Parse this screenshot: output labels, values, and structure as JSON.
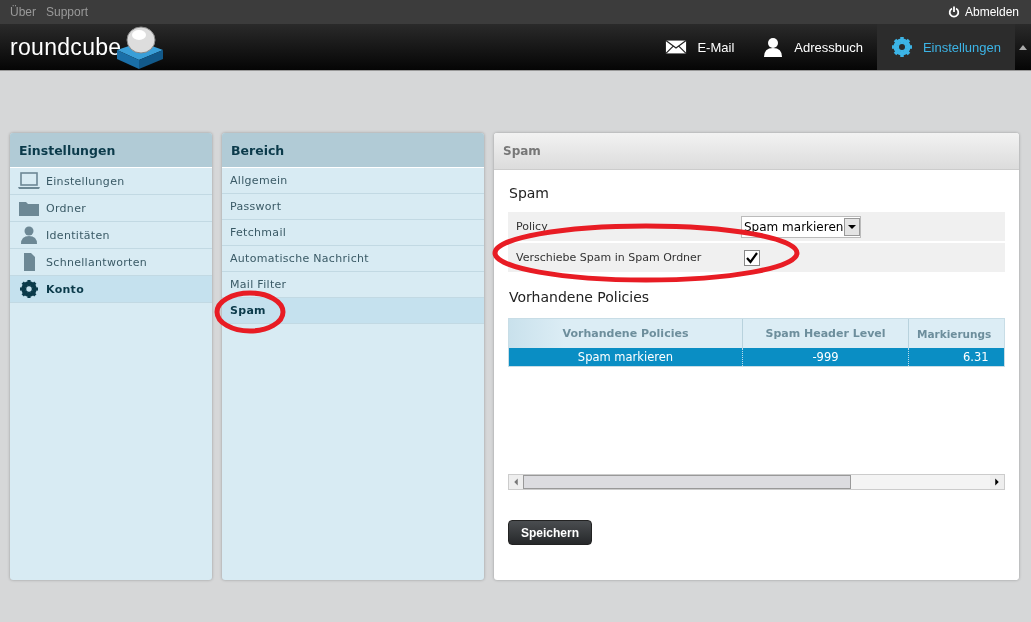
{
  "top_bar": {
    "links": [
      "Über",
      "Support"
    ],
    "logout": "Abmelden"
  },
  "header": {
    "logo": "roundcube",
    "nav": [
      {
        "label": "E-Mail",
        "kind": "mail",
        "selected": false
      },
      {
        "label": "Adressbuch",
        "kind": "contacts",
        "selected": false
      },
      {
        "label": "Einstellungen",
        "kind": "settings",
        "selected": true
      }
    ]
  },
  "settings_panel": {
    "title": "Einstellungen",
    "items": [
      {
        "label": "Einstellungen",
        "kind": "preferences",
        "selected": false
      },
      {
        "label": "Ordner",
        "kind": "folders",
        "selected": false
      },
      {
        "label": "Identitäten",
        "kind": "identities",
        "selected": false
      },
      {
        "label": "Schnellantworten",
        "kind": "responses",
        "selected": false
      },
      {
        "label": "Konto",
        "kind": "account",
        "selected": true
      }
    ]
  },
  "section_panel": {
    "title": "Bereich",
    "items": [
      {
        "label": "Allgemein",
        "selected": false
      },
      {
        "label": "Passwort",
        "selected": false
      },
      {
        "label": "Fetchmail",
        "selected": false
      },
      {
        "label": "Automatische Nachricht",
        "selected": false
      },
      {
        "label": "Mail Filter",
        "selected": false
      },
      {
        "label": "Spam",
        "selected": true
      }
    ]
  },
  "content": {
    "header": "Spam",
    "section_title": "Spam",
    "form": [
      {
        "kind": "select",
        "label": "Policy",
        "value": "Spam markieren"
      },
      {
        "kind": "checkbox",
        "label": "Verschiebe Spam in Spam Ordner",
        "checked": true
      }
    ],
    "policies_title": "Vorhandene Policies",
    "table": {
      "columns": [
        "Vorhandene Policies",
        "Spam Header Level",
        "Markierungs"
      ],
      "rows": [
        {
          "cells": [
            "Spam markieren",
            "-999",
            "6.31"
          ],
          "selected": true
        }
      ]
    },
    "save_button": "Speichern"
  }
}
